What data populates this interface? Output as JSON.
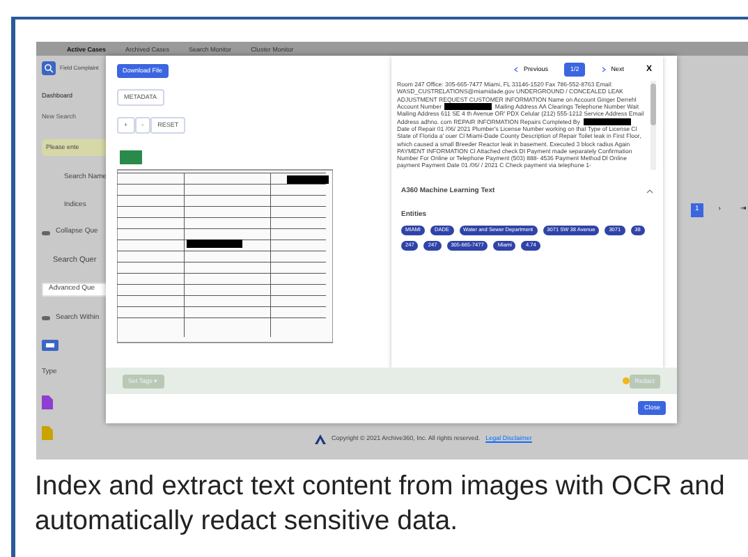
{
  "app": {
    "tabs": [
      {
        "label": "Active Cases",
        "selected": true
      },
      {
        "label": "Archived Cases",
        "selected": false
      },
      {
        "label": "Search Monitor",
        "selected": false
      },
      {
        "label": "Cluster Monitor",
        "selected": false
      }
    ],
    "case_title": "Field Complaint",
    "nav": [
      {
        "label": "Dashboard",
        "selected": true
      },
      {
        "label": "New Search",
        "selected": false
      }
    ],
    "form_labels": [
      "Search Name",
      "Indices"
    ],
    "notice": "Please ente",
    "options": [
      {
        "kind": "toggle",
        "label": "Collapse Que"
      },
      {
        "kind": "heading",
        "label": "Search Quer"
      },
      {
        "kind": "select",
        "label": "Advanced Que"
      },
      {
        "kind": "toggle",
        "label": "Search Within"
      }
    ],
    "type_label": "Type",
    "files": [
      {
        "color": "#8e3fd0"
      },
      {
        "color": "#c9a300"
      }
    ],
    "pagination": [
      "1",
      "›",
      "⇥"
    ],
    "copyright": "Copyright © 2021 Archive360, Inc. All rights reserved.",
    "legal_link": "Legal Disclaimer"
  },
  "modal": {
    "download_button": "Download File",
    "metadata_button": "METADATA",
    "zoom_buttons": [
      "+",
      "-",
      "RESET"
    ],
    "pager": {
      "previous": "Previous",
      "page": "1/2",
      "next": "Next",
      "close": "X"
    },
    "ocr_text": [
      {
        "kind": "text",
        "text": "Room 247 Office: 305-665-7477 Miami, FL 33146-1520 Fax 786-552-8763 Email: WASD_CUSTRELATIONS@miamidade.gov UNDERGROUND / CONCEALED LEAK ADJUSTMENT REQUEST CUSTOMER INFORMATION Name on Account Ginger Derrehl Account Number"
      },
      {
        "kind": "redaction"
      },
      {
        "kind": "text",
        "text": "Mailing Address AA Clearings Telephone Number Wait Mailing Address 611 SE 4 th Avenue OR' PDX Celular (212) 555-1212 Service Address Email Address adhno. com REPAIR INFORMATION Repairs Completed By"
      },
      {
        "kind": "redaction"
      },
      {
        "kind": "text",
        "text": "Date of Repair 01 /06/ 2021 Plumber's License Number working on that Type of License Cl State of Florida a' ouer Cl Miami-Dade County Description of Repair Toilet leak in First Floor, which caused a small Breeder Reactor leak in basement. Executed 3 block radius Again PAYMENT INFORMATION Cl Attached check DI Payment made separately Confirmation Number For Online or Telephone Payment (503) 888- 4536 Payment Method Dl Online payment Payment Date 01 /06/ / 2021 C Check payment via telephone 1-"
      }
    ],
    "section": {
      "title": "A360 Machine Learning Text",
      "expanded": true
    },
    "entities_label": "Entities",
    "entities": [
      "MIAMI",
      "DADE",
      "Water and Sewer Department",
      "3071 SW 38 Avenue",
      "3071",
      "38",
      "247",
      "247",
      "305-665-7477",
      "Miami",
      "4.74"
    ],
    "set_tags": {
      "label": "Set Tags ▾",
      "disabled": true
    },
    "redact": {
      "label": "Redact",
      "disabled": true
    },
    "close_button": "Close"
  },
  "caption": "Index and extract text content from images with OCR and automatically redact sensitive data."
}
